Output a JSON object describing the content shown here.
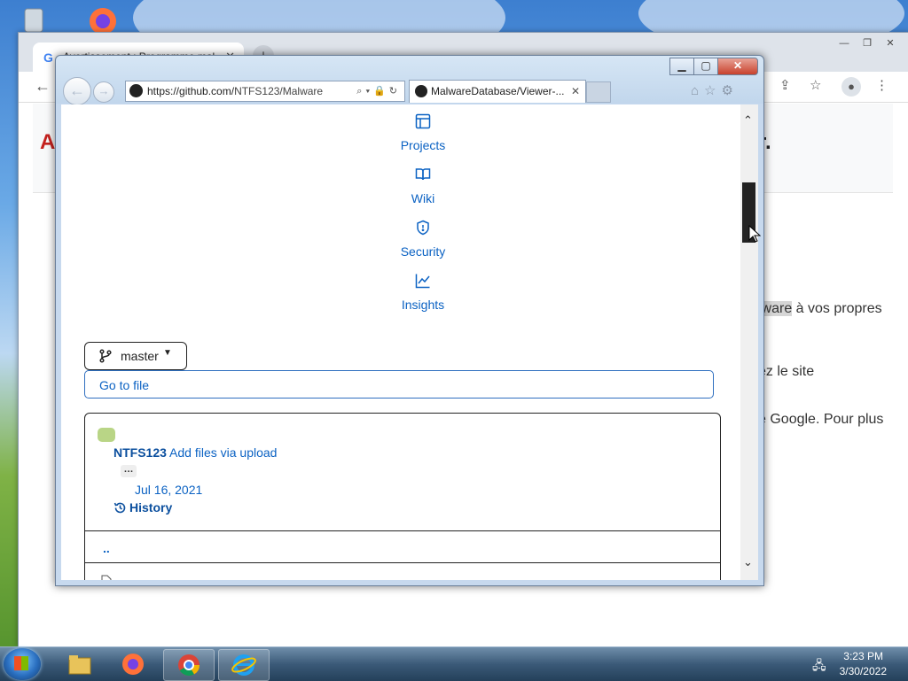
{
  "chrome": {
    "tab_title": "Avertissement : Programme mal...",
    "tab_icon": "google-g-icon",
    "header_left": "A",
    "header_right": "r.",
    "text_line1_hl": "lware",
    "text_line1": " à vos propres",
    "text_line2": "ez le site",
    "text_line3": "e Google. Pour plus"
  },
  "ie": {
    "url": "https://github.com/",
    "url_path": "NTFS123/Malware",
    "tab_title": "MalwareDatabase/Viewer-..."
  },
  "github": {
    "nav": [
      {
        "label": "Projects",
        "icon": "projects-icon"
      },
      {
        "label": "Wiki",
        "icon": "book-icon"
      },
      {
        "label": "Security",
        "icon": "shield-icon"
      },
      {
        "label": "Insights",
        "icon": "graph-icon"
      }
    ],
    "branch": "master",
    "goto_file": "Go to file",
    "commit": {
      "author": "NTFS123",
      "message": "Add files via upload",
      "ellipsis": "…",
      "date": "Jul 16, 2021",
      "history": "History"
    },
    "parent_dir": ".."
  },
  "taskbar": {
    "time": "3:23 PM",
    "date": "3/30/2022"
  },
  "colors": {
    "link": "#0b62c3",
    "ie_close": "#c8412c",
    "chrome_warning": "#c5221f"
  }
}
